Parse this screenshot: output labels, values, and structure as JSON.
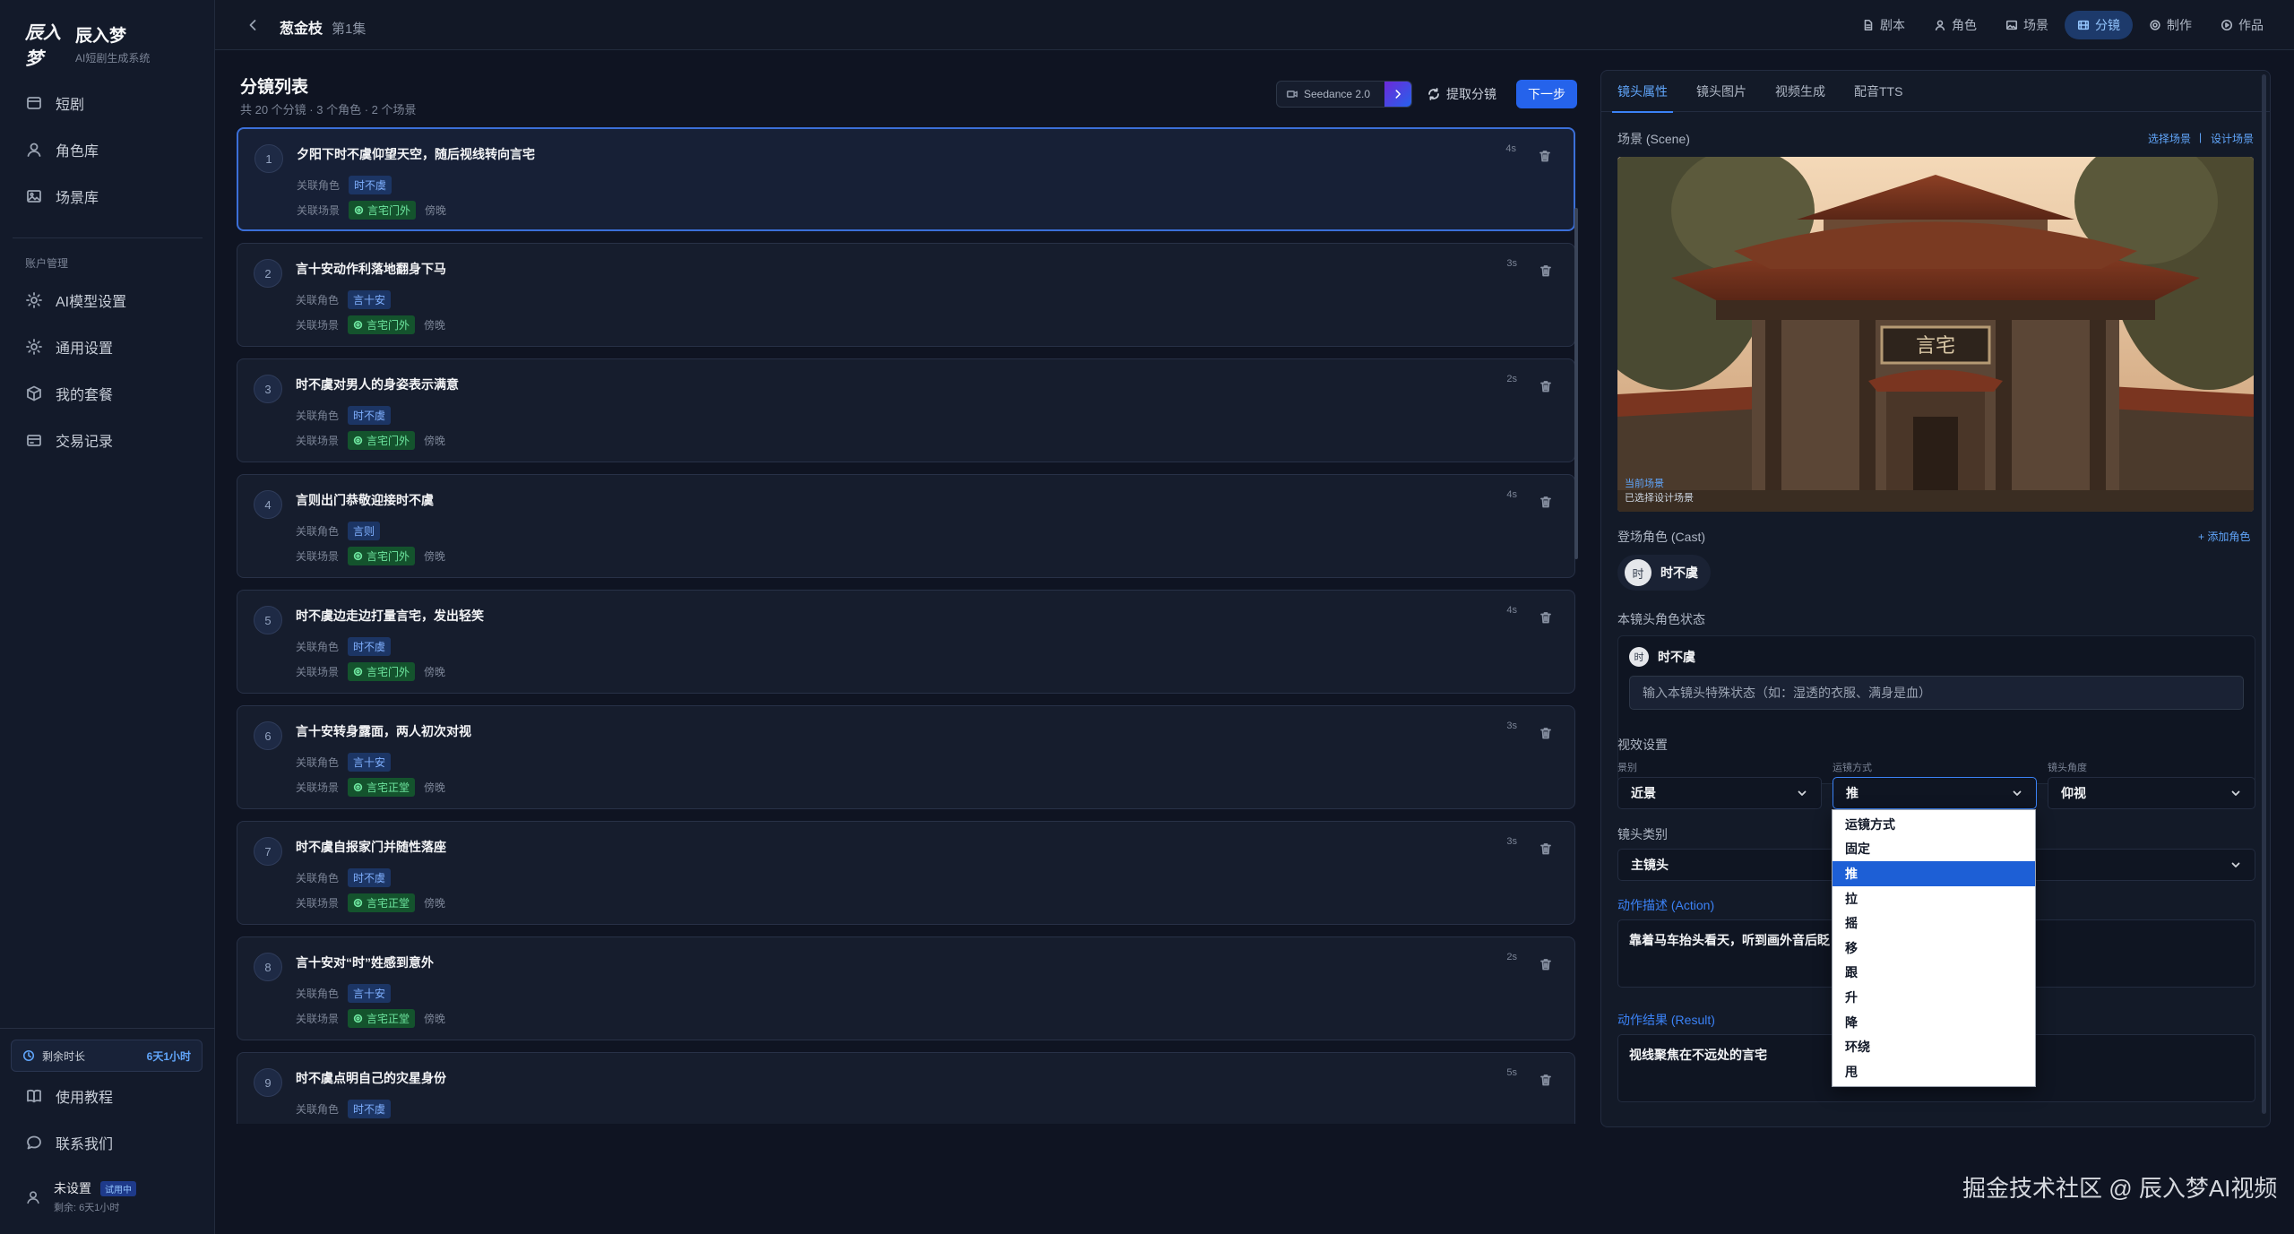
{
  "brand": {
    "logo": "辰入梦",
    "name": "辰入梦",
    "subtitle": "AI短剧生成系统"
  },
  "sidebar": {
    "items": [
      {
        "label": "短剧",
        "icon": "drama-icon"
      },
      {
        "label": "角色库",
        "icon": "user-icon"
      },
      {
        "label": "场景库",
        "icon": "image-icon"
      }
    ],
    "section_label": "账户管理",
    "account_items": [
      {
        "label": "AI模型设置",
        "icon": "gear-icon"
      },
      {
        "label": "通用设置",
        "icon": "gear-icon"
      },
      {
        "label": "我的套餐",
        "icon": "package-icon"
      },
      {
        "label": "交易记录",
        "icon": "wallet-icon"
      }
    ],
    "remaining": {
      "label": "剩余时长",
      "value": "6天1小时"
    },
    "bottom_items": [
      {
        "label": "使用教程",
        "icon": "book-icon"
      },
      {
        "label": "联系我们",
        "icon": "chat-icon"
      }
    ],
    "user": {
      "name": "未设置",
      "badge": "试用中",
      "sub": "剩余: 6天1小时"
    }
  },
  "topbar": {
    "title": "葱金枝",
    "episode": "第1集",
    "nav": [
      {
        "label": "剧本",
        "icon": "file-icon",
        "active": false
      },
      {
        "label": "角色",
        "icon": "user-icon",
        "active": false
      },
      {
        "label": "场景",
        "icon": "image-icon",
        "active": false
      },
      {
        "label": "分镜",
        "icon": "film-icon",
        "active": true
      },
      {
        "label": "制作",
        "icon": "gear-icon",
        "active": false
      },
      {
        "label": "作品",
        "icon": "play-icon",
        "active": false
      }
    ]
  },
  "shots": {
    "title": "分镜列表",
    "summary": "共 20 个分镜 · 3 个角色 · 2 个场景",
    "model": "Seedance 2.0",
    "extract_label": "提取分镜",
    "next_label": "下一步",
    "role_key": "关联角色",
    "scene_key": "关联场景",
    "items": [
      {
        "num": "1",
        "title": "夕阳下时不虞仰望天空，随后视线转向言宅",
        "role": "时不虞",
        "scene": "言宅门外",
        "time": "傍晚",
        "duration": "4s"
      },
      {
        "num": "2",
        "title": "言十安动作利落地翻身下马",
        "role": "言十安",
        "scene": "言宅门外",
        "time": "傍晚",
        "duration": "3s"
      },
      {
        "num": "3",
        "title": "时不虞对男人的身姿表示满意",
        "role": "时不虞",
        "scene": "言宅门外",
        "time": "傍晚",
        "duration": "2s"
      },
      {
        "num": "4",
        "title": "言则出门恭敬迎接时不虞",
        "role": "言则",
        "scene": "言宅门外",
        "time": "傍晚",
        "duration": "4s"
      },
      {
        "num": "5",
        "title": "时不虞边走边打量言宅，发出轻笑",
        "role": "时不虞",
        "scene": "言宅门外",
        "time": "傍晚",
        "duration": "4s"
      },
      {
        "num": "6",
        "title": "言十安转身露面，两人初次对视",
        "role": "言十安",
        "scene": "言宅正堂",
        "time": "傍晚",
        "duration": "3s"
      },
      {
        "num": "7",
        "title": "时不虞自报家门并随性落座",
        "role": "时不虞",
        "scene": "言宅正堂",
        "time": "傍晚",
        "duration": "3s"
      },
      {
        "num": "8",
        "title": "言十安对“时”姓感到意外",
        "role": "言十安",
        "scene": "言宅正堂",
        "time": "傍晚",
        "duration": "2s"
      },
      {
        "num": "9",
        "title": "时不虞点明自己的灾星身份",
        "role": "时不虞",
        "scene": "言宅正堂",
        "time": "傍晚",
        "duration": "5s"
      }
    ]
  },
  "panel": {
    "tabs": [
      "镜头属性",
      "镜头图片",
      "视频生成",
      "配音TTS"
    ],
    "scene_label": "场景 (Scene)",
    "scene_links": [
      "选择场景",
      "设计场景"
    ],
    "scene_sign": "言宅",
    "scene_overlay": [
      "当前场景",
      "已选择设计场景"
    ],
    "cast_label": "登场角色 (Cast)",
    "add_role": "+ 添加角色",
    "cast": [
      {
        "name": "时不虞",
        "initial": "时"
      }
    ],
    "state_label": "本镜头角色状态",
    "state_role": "时不虞",
    "state_placeholder": "输入本镜头特殊状态（如：湿透的衣服、满身是血）",
    "visual_label": "视效设置",
    "shot_size_label": "景别",
    "shot_size": "近景",
    "camera_move_label": "运镜方式",
    "camera_move": "推",
    "angle_label": "镜头角度",
    "angle": "仰视",
    "shot_type_label": "镜头类别",
    "shot_type": "主镜头",
    "action_label": "动作描述 (Action)",
    "action_text": "靠着马车抬头看天，听到画外音后眨",
    "result_label": "动作结果 (Result)",
    "result_text": "视线聚焦在不远处的言宅",
    "camera_move_options": [
      "运镜方式",
      "固定",
      "推",
      "拉",
      "摇",
      "移",
      "跟",
      "升",
      "降",
      "环绕",
      "甩"
    ]
  },
  "watermark": "掘金技术社区 @ 辰入梦AI视频"
}
